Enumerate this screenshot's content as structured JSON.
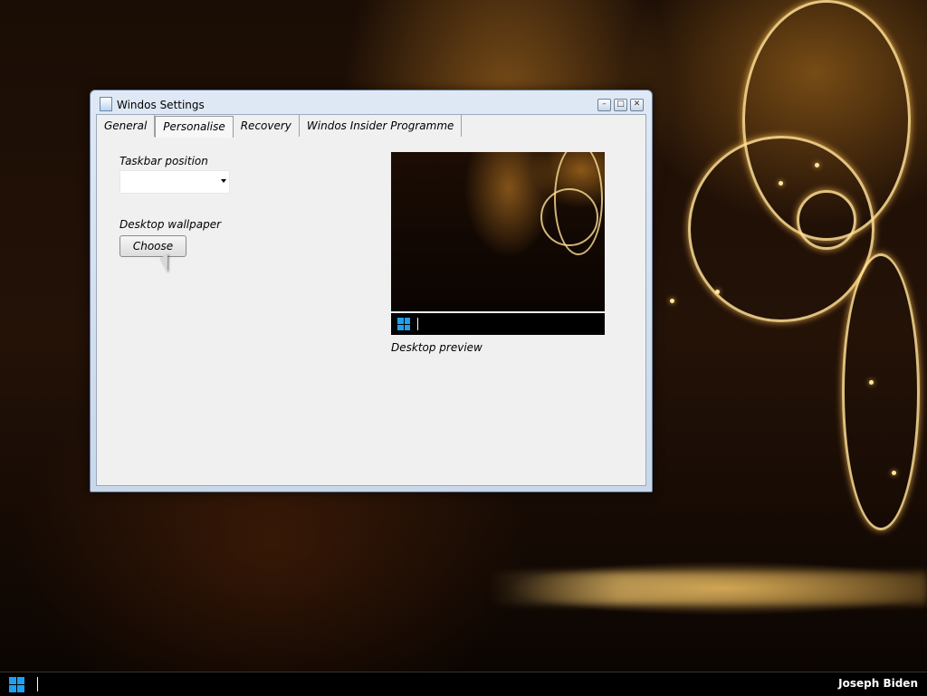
{
  "window": {
    "title": "Windos Settings",
    "controls": {
      "minimize": "–",
      "maximize": "□",
      "close": "✕"
    },
    "tabs": [
      {
        "label": "General",
        "active": false
      },
      {
        "label": "Personalise",
        "active": true
      },
      {
        "label": "Recovery",
        "active": false
      },
      {
        "label": "Windos Insider Programme",
        "active": false
      }
    ]
  },
  "personalise": {
    "taskbar_position_label": "Taskbar position",
    "taskbar_position_value": "",
    "desktop_wallpaper_label": "Desktop wallpaper",
    "choose_button": "Choose",
    "preview_caption": "Desktop preview"
  },
  "taskbar": {
    "user_name": "Joseph Biden",
    "start_icon": "windows-logo-icon"
  },
  "colors": {
    "accent": "#1da1f2",
    "window_client": "#f0f0f0",
    "taskbar": "#000000"
  }
}
